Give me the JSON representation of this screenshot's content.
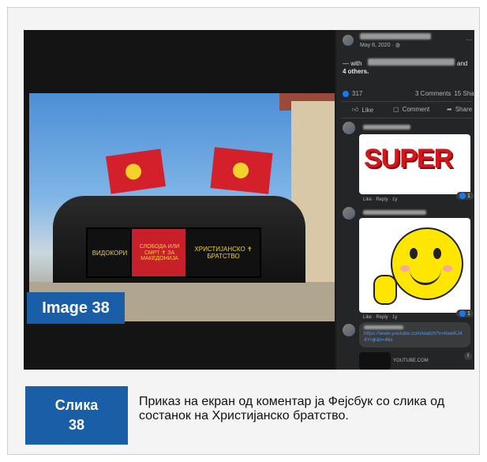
{
  "badge_image": "Image 38",
  "facebook": {
    "date": "May 8, 2020 · ",
    "globe_icon": "globe-icon",
    "with_prefix": "— with",
    "with_and": "and",
    "others": "4 others.",
    "reaction_count": "317",
    "comments": "3 Comments",
    "shares": "15 Sha",
    "like_label": "Like",
    "comment_label": "Comment",
    "share_label": "Share",
    "comment1": {
      "sticker_text": "SUPER",
      "actions": "Like · Reply · 1y",
      "reaction": "1"
    },
    "comment2": {
      "actions": "Like · Reply · 1y",
      "reaction": "1"
    },
    "comment3": {
      "link": "https://www.youtube.com/watch?v=hweKJ44Ynjk&t=46s",
      "source": "YOUTUBE.COM"
    },
    "more_label": "···"
  },
  "photo": {
    "banner_left": "ВИДОКОРИ",
    "banner_mid": "СЛОБОДА ИЛИ СМРТ ✝ ЗА МАКЕДОНИЈА",
    "banner_right": "ХРИСТИЈАНСКО ✝ БРАТСТВО"
  },
  "slika": {
    "label": "Слика",
    "number": "38"
  },
  "caption": "Приказ на екран од коментар ја Фејсбук со слика од состанок на Христијанско братство.",
  "colors": {
    "accent": "#1b5ea8",
    "fb_bg": "#242526",
    "link": "#4599ff"
  }
}
